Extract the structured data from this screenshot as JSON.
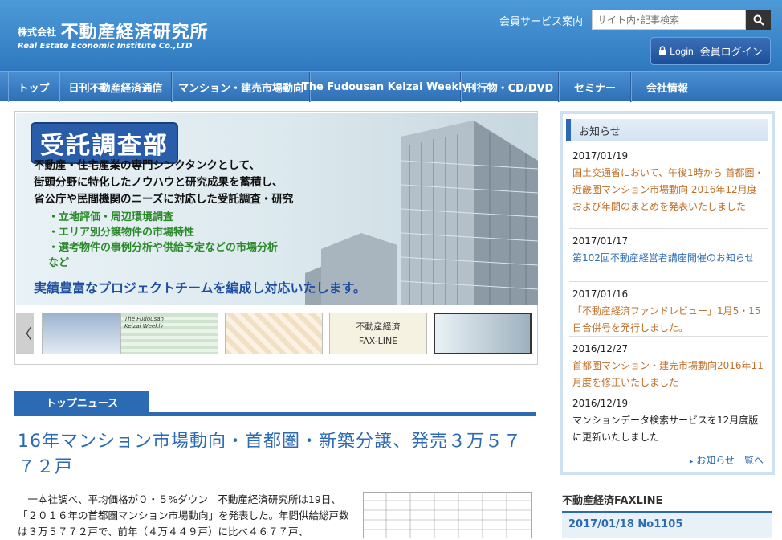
{
  "header": {
    "logo_prefix": "株式会社",
    "logo_name": "不動産経済研究所",
    "logo_en": "Real Estate Economic Institute Co.,LTD",
    "member_link": "会員サービス案内",
    "search_placeholder": "サイト内･記事検索",
    "login_en": "Login",
    "login_jp": "会員ログイン"
  },
  "nav": [
    {
      "label": "トップ"
    },
    {
      "label": "日刊不動産経済通信"
    },
    {
      "label": "マンション・建売市場動向"
    },
    {
      "label": "The Fudousan Keizai Weekly"
    },
    {
      "label": "刊行物・CD/DVD"
    },
    {
      "label": "セミナー"
    },
    {
      "label": "会社情報"
    }
  ],
  "banner": {
    "title": "受託調査部",
    "lines": [
      "不動産・住宅産業の専門シンクタンクとして、",
      "街頭分野に特化したノウハウと研究成果を蓄積し、",
      "省公庁や民間機関のニーズに対応した受託調査・研究"
    ],
    "bullets": [
      "・立地評価・周辺環境調査",
      "・エリア別分譲物件の市場特性",
      "・選考物件の事例分析や供給予定などの市場分析",
      "など"
    ],
    "bottom": "実績豊富なプロジェクトチームを編成し対応いたします。",
    "prev_arrow": "〈",
    "thumb_weekly": "The Fudousan Keizai Weekly",
    "thumb_fax_title": "不動産経済",
    "thumb_fax_name": "FAX-LINE"
  },
  "news": {
    "tab": "トップニュース",
    "headline": "16年マンション市場動向・首都圏・新築分譲、発売３万５７７２戸",
    "body": "　一本社調べ、平均価格が０・５%ダウン　不動産経済研究所は19日、「２０１６年の首都圏マンション市場動向」を発表した。年間供給総戸数は３万５７７２戸で、前年（４万４４９戸）に比べ４６７７戸、"
  },
  "notice": {
    "title": "お知らせ",
    "items": [
      {
        "date": "2017/01/19",
        "text": "国土交通省において、午後1時から 首都圏・近畿圏マンション市場動向 2016年12月度および年間のまとめを発表いたしました"
      },
      {
        "date": "2017/01/17",
        "text": "第102回不動産経営者講座開催のお知らせ"
      },
      {
        "date": "2017/01/16",
        "text": "「不動産経済ファンドレビュー」1月5・15日合併号を発行しました。"
      },
      {
        "date": "2016/12/27",
        "text": "首都圏マンション・建売市場動向2016年11月度を修正いたしました"
      },
      {
        "date": "2016/12/19",
        "text": "マンションデータ検索サービスを12月度版に更新いたしました"
      }
    ],
    "more": "お知らせ一覧へ"
  },
  "fax": {
    "title": "不動産経済FAXLINE",
    "latest": "2017/01/18 No1105"
  },
  "colors": {
    "brand_blue": "#2c6ab3",
    "notice_link": "#c0702a"
  }
}
